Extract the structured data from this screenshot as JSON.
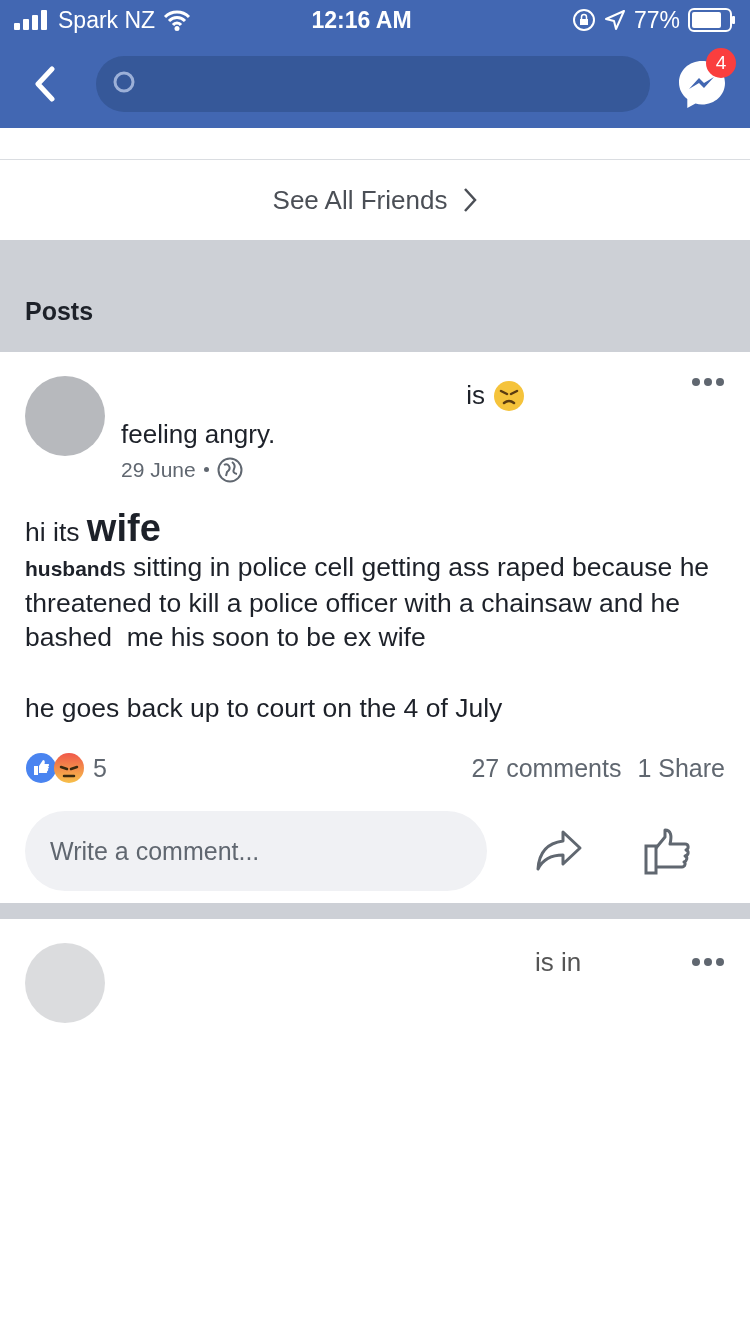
{
  "status_bar": {
    "carrier": "Spark NZ",
    "time": "12:16 AM",
    "battery": "77%"
  },
  "header": {
    "messenger_badge": "4"
  },
  "friends": {
    "see_all": "See All Friends"
  },
  "section_title": "Posts",
  "post": {
    "verb": "is",
    "feeling": "feeling angry.",
    "date": "29 June",
    "body": [
      "hi its **wife**",
      "**husband**s sitting in police cell getting ass raped because he threatened to kill a police officer with a chainsaw and he  bashed  me his soon to be ex wife",
      "he goes back up to court on the 4 of July"
    ],
    "reaction_count": "5",
    "comments": "27 comments",
    "shares": "1 Share",
    "comment_placeholder": "Write a comment..."
  },
  "next_post": {
    "text": "is in"
  }
}
